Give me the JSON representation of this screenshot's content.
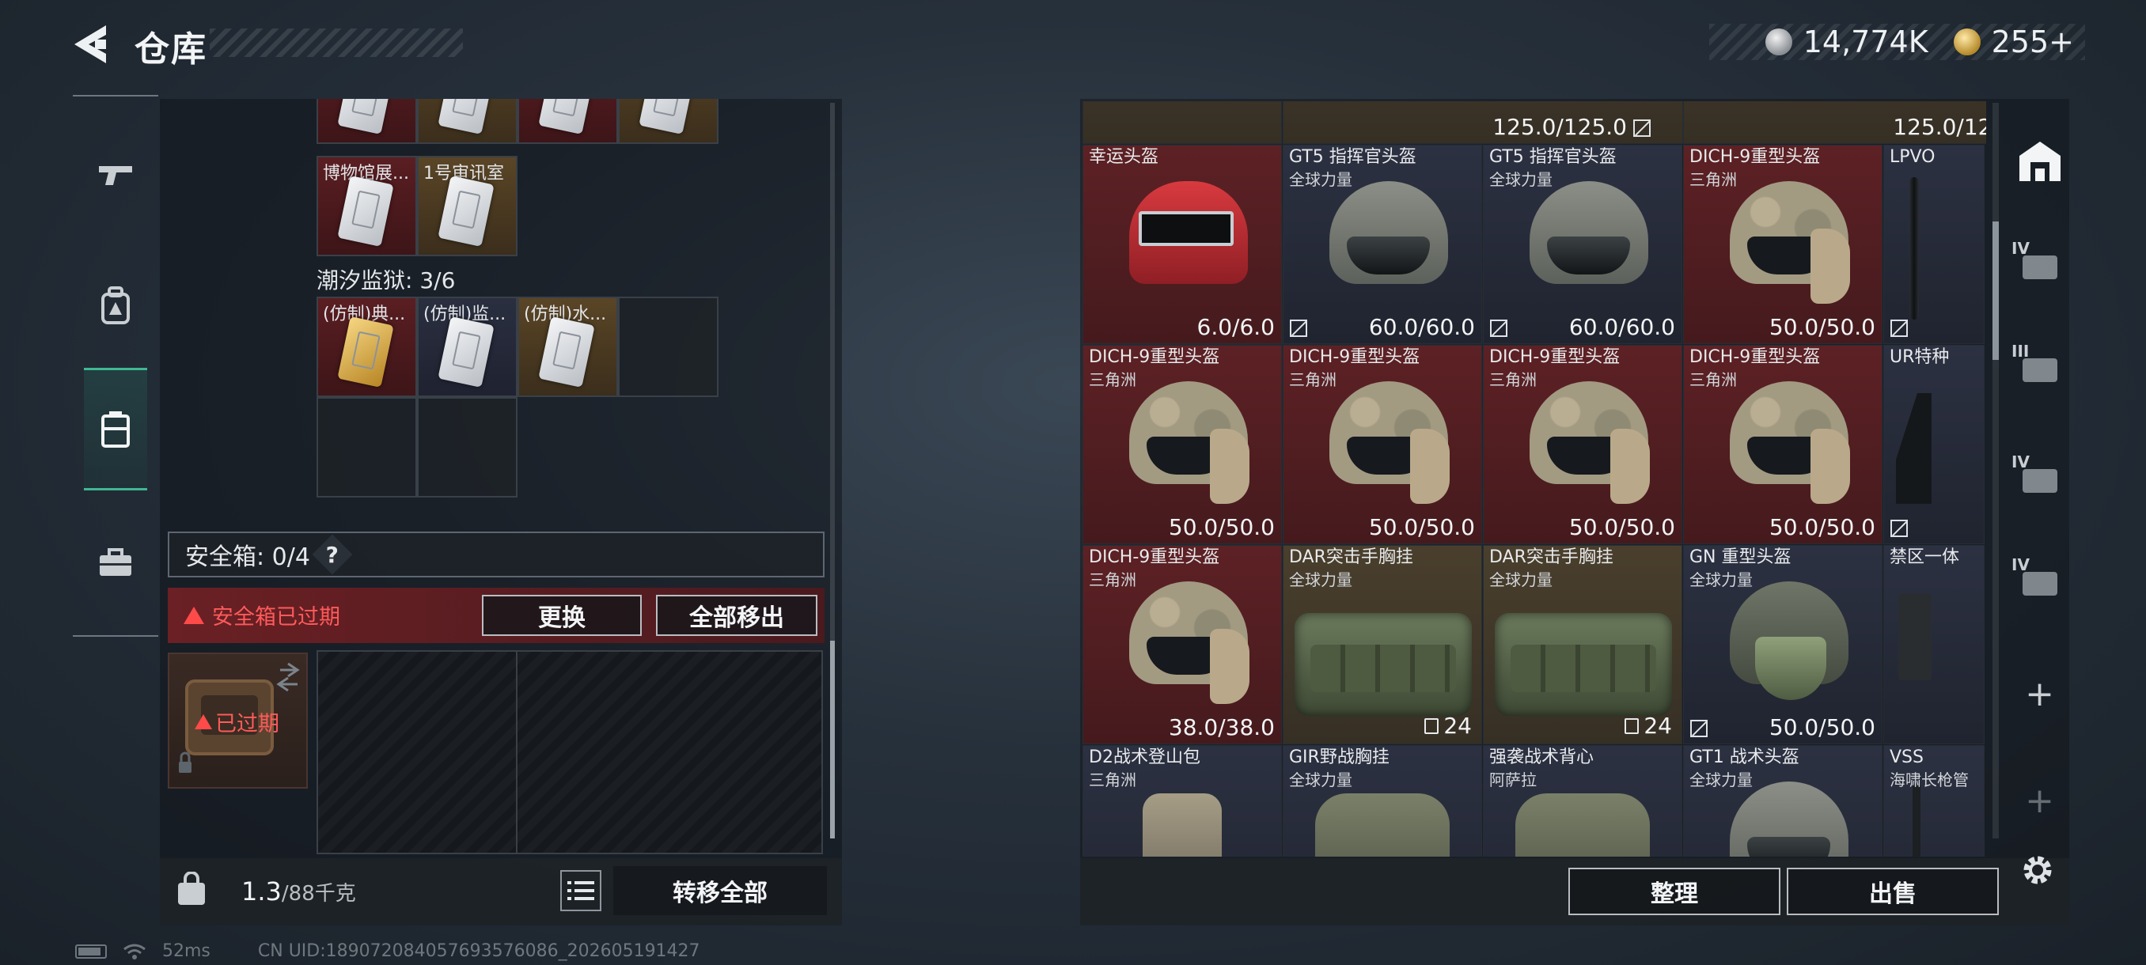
{
  "header": {
    "title": "仓库"
  },
  "currency": {
    "silver_value": "14,774K",
    "gold_value": "255+"
  },
  "left_tabs": [
    {
      "icon": "gun-icon"
    },
    {
      "icon": "backpack-icon"
    },
    {
      "icon": "container-icon",
      "active": true
    },
    {
      "icon": "briefcase-icon"
    }
  ],
  "stash": {
    "top_row_count": 4,
    "museum_items": [
      {
        "label": "博物馆展..."
      },
      {
        "label": "1号审讯室"
      }
    ],
    "tide_prison_label": "潮汐监狱: 3/6",
    "tide_items": [
      {
        "label": "(仿制)典..."
      },
      {
        "label": "(仿制)监..."
      },
      {
        "label": "(仿制)水..."
      }
    ]
  },
  "safebox": {
    "label": "安全箱: 0/4",
    "help": "?",
    "expired_notice": "安全箱已过期",
    "replace_label": "更换",
    "move_all_label": "全部移出",
    "icon_status": "已过期"
  },
  "footer_left": {
    "weight_current": "1.3",
    "weight_max": "/88千克",
    "transfer_all_label": "转移全部"
  },
  "warehouse": {
    "top_partial": [
      {
        "durability": "125.0/125.0"
      },
      {
        "durability": "125.0/125.0"
      }
    ],
    "rows": [
      [
        {
          "name": "幸运头盔",
          "sub": "",
          "durability": "6.0/6.0",
          "bg": "red",
          "art": "helmet-red"
        },
        {
          "name": "GT5 指挥官头盔",
          "sub": "全球力量",
          "durability": "60.0/60.0",
          "bg": "navy",
          "art": "helmet-tac"
        },
        {
          "name": "GT5 指挥官头盔",
          "sub": "全球力量",
          "durability": "60.0/60.0",
          "bg": "navy",
          "art": "helmet-tac"
        },
        {
          "name": "DICH-9重型头盔",
          "sub": "三角洲",
          "durability": "50.0/50.0",
          "bg": "red",
          "art": "helmet-camo"
        },
        {
          "name": "LPVO",
          "sub": "",
          "durability": "",
          "bg": "navy",
          "art": "scope"
        }
      ],
      [
        {
          "name": "DICH-9重型头盔",
          "sub": "三角洲",
          "durability": "50.0/50.0",
          "bg": "red",
          "art": "helmet-camo"
        },
        {
          "name": "DICH-9重型头盔",
          "sub": "三角洲",
          "durability": "50.0/50.0",
          "bg": "red",
          "art": "helmet-camo"
        },
        {
          "name": "DICH-9重型头盔",
          "sub": "三角洲",
          "durability": "50.0/50.0",
          "bg": "red",
          "art": "helmet-camo"
        },
        {
          "name": "DICH-9重型头盔",
          "sub": "三角洲",
          "durability": "50.0/50.0",
          "bg": "red",
          "art": "helmet-camo"
        },
        {
          "name": "UR特种",
          "sub": "",
          "durability": "",
          "bg": "navy",
          "art": "stock"
        }
      ],
      [
        {
          "name": "DICH-9重型头盔",
          "sub": "三角洲",
          "durability": "38.0/38.0",
          "bg": "red",
          "art": "helmet-camo"
        },
        {
          "name": "DAR突击手胸挂",
          "sub": "全球力量",
          "count": "24",
          "bg": "olive",
          "art": "rig"
        },
        {
          "name": "DAR突击手胸挂",
          "sub": "全球力量",
          "count": "24",
          "bg": "olive",
          "art": "rig"
        },
        {
          "name": "GN 重型头盔",
          "sub": "全球力量",
          "durability": "50.0/50.0",
          "bg": "navy",
          "art": "helmet-gn"
        },
        {
          "name": "禁区一体",
          "sub": "",
          "durability": "",
          "bg": "navy",
          "art": "grip"
        }
      ],
      [
        {
          "name": "D2战术登山包",
          "sub": "三角洲",
          "durability": "",
          "bg": "navy",
          "art": "bag"
        },
        {
          "name": "GIR野战胸挂",
          "sub": "全球力量",
          "durability": "",
          "bg": "navy",
          "art": "vest"
        },
        {
          "name": "强袭战术背心",
          "sub": "阿萨拉",
          "durability": "",
          "bg": "navy",
          "art": "vest"
        },
        {
          "name": "GT1 战术头盔",
          "sub": "全球力量",
          "durability": "",
          "bg": "navy",
          "art": "helmet-tac"
        },
        {
          "name": "VSS",
          "sub": "海啸长枪管",
          "durability": "",
          "bg": "navy",
          "art": "barrel"
        }
      ]
    ]
  },
  "tools": [
    {
      "icon": "warehouse-icon",
      "level": ""
    },
    {
      "icon": "medkit-station-icon",
      "level": "IV"
    },
    {
      "icon": "armory-station-icon",
      "level": "III"
    },
    {
      "icon": "tech-station-icon",
      "level": "IV"
    },
    {
      "icon": "workbench-station-icon",
      "level": "IV"
    }
  ],
  "footer_right": {
    "sort_label": "整理",
    "sell_label": "出售"
  },
  "status": {
    "ping": "52ms",
    "uid": "CN UID:18907208405769357608​6_202605191427"
  },
  "colors": {
    "accent": "#3fb894",
    "danger": "#ff4a4a",
    "rarity_red": "#5d2125",
    "rarity_gold": "#4a3f2d",
    "rarity_blue": "#2c3142"
  }
}
